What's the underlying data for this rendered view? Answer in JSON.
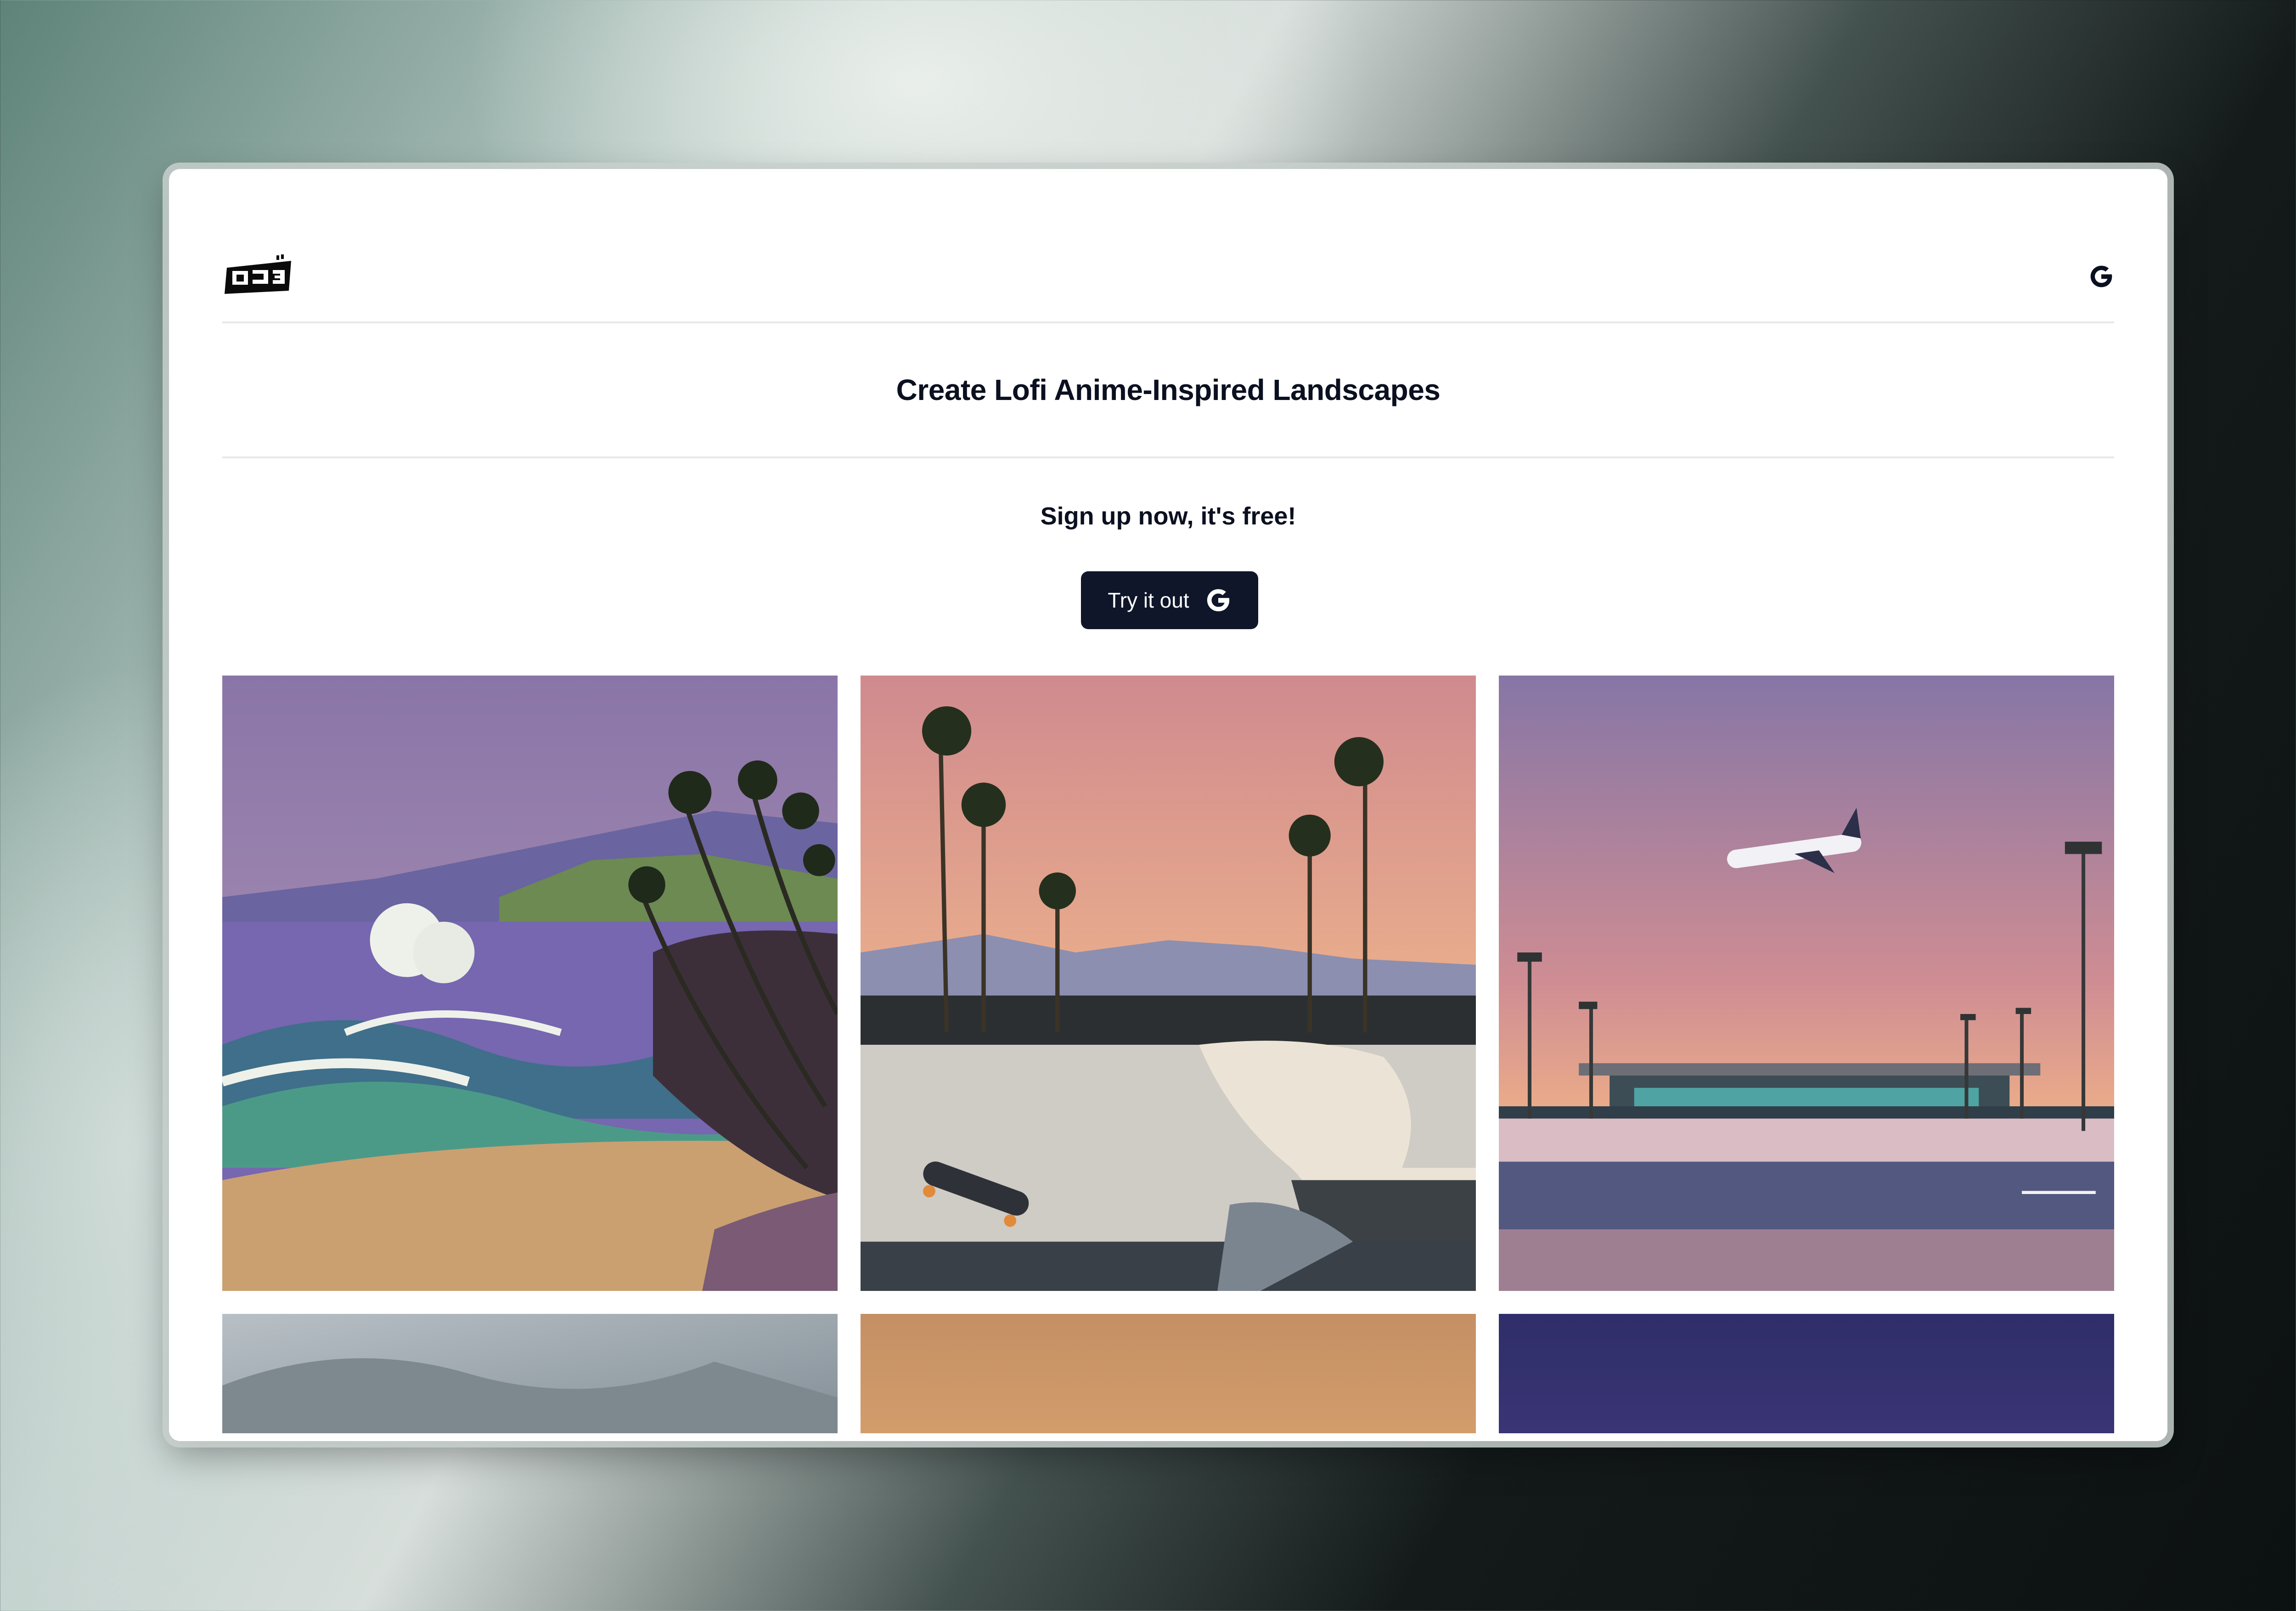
{
  "header": {
    "logo_icon": "lofi-logo-icon",
    "account_icon": "google-g-icon"
  },
  "hero": {
    "title": "Create Lofi Anime-Inspired Landscapes",
    "signup_text": "Sign up now, it's free!",
    "cta_label": "Try it out",
    "cta_icon": "google-g-icon"
  },
  "gallery": {
    "items": [
      {
        "scene": "coastal-waves-palms"
      },
      {
        "scene": "skatepark-sunset-palms"
      },
      {
        "scene": "airport-runway-airplane"
      },
      {
        "scene": "cloudy-sky"
      },
      {
        "scene": "orange-sky"
      },
      {
        "scene": "indigo-sky"
      }
    ]
  },
  "colors": {
    "primary_button": "#0f1629",
    "text": "#0b1020",
    "divider": "#e6e7ea"
  }
}
